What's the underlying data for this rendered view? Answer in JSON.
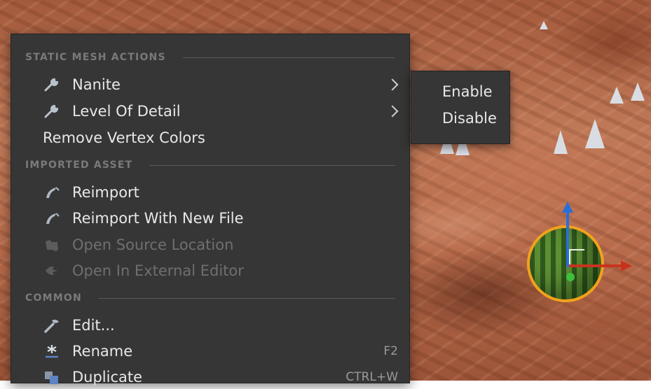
{
  "menu": {
    "sections": {
      "static_mesh_actions": "STATIC MESH ACTIONS",
      "imported_asset": "IMPORTED ASSET",
      "common": "COMMON"
    },
    "items": {
      "nanite": {
        "label": "Nanite",
        "icon": "wrench-icon",
        "submenu": true
      },
      "lod": {
        "label": "Level Of Detail",
        "icon": "wrench-icon",
        "submenu": true
      },
      "remove_vertex_colors": {
        "label": "Remove Vertex Colors"
      },
      "reimport": {
        "label": "Reimport",
        "icon": "reimport-icon"
      },
      "reimport_new_file": {
        "label": "Reimport With New File",
        "icon": "reimport-icon"
      },
      "open_source_location": {
        "label": "Open Source Location",
        "icon": "folder-icon",
        "disabled": true
      },
      "open_external_editor": {
        "label": "Open In External Editor",
        "icon": "external-editor-icon",
        "disabled": true
      },
      "edit": {
        "label": "Edit...",
        "icon": "edit-icon"
      },
      "rename": {
        "label": "Rename",
        "icon": "rename-icon",
        "shortcut": "F2"
      },
      "duplicate": {
        "label": "Duplicate",
        "icon": "duplicate-icon",
        "shortcut": "CTRL+W"
      }
    }
  },
  "submenu": {
    "enable": "Enable",
    "disable": "Disable"
  },
  "colors": {
    "menu_bg": "#363636",
    "text": "#e8e8e8",
    "disabled_text": "#6f6f6f",
    "section_text": "#7a7a7a",
    "selection_outline": "#f1a11c",
    "gizmo_x": "#c8331e",
    "gizmo_z": "#2a6fd6",
    "gizmo_y": "#3fbf3c"
  }
}
